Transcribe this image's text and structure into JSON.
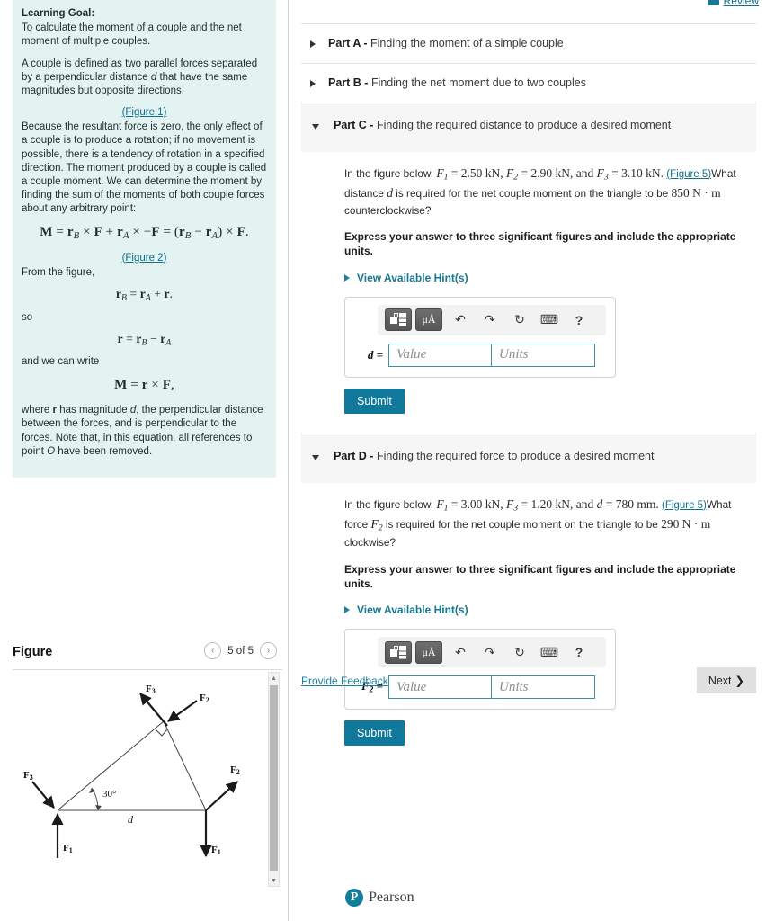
{
  "left_panel": {
    "learning_goal_title": "Learning Goal:",
    "learning_goal_text": "To calculate the moment of a couple and the net moment of multiple couples.",
    "para_couple_definition": "A couple is defined as two parallel forces separated by a perpendicular distance d that have the same magnitudes but opposite directions.",
    "figure1_link": "(Figure 1)",
    "para_resultant": "Because the resultant force is zero, the only effect of a couple is to produce a rotation; if no movement is possible, there is a tendency of rotation in a specified direction. The moment produced by a couple is called a couple moment. We can determine the moment by finding the sum of the moments of both couple forces about any arbitrary point:",
    "equation_main": "M = r_B × F + r_A × −F = (r_B − r_A) × F.",
    "figure2_link": "(Figure 2)",
    "from_the_figure": "From the figure,",
    "equation_rb": "r_B = r_A + r,",
    "so_label": "so",
    "equation_r": "r = r_B − r_A",
    "and_we_can_write": "and we can write",
    "equation_m": "M = r × F,",
    "para_where": "where r has magnitude d, the perpendicular distance between the forces, and is perpendicular to the forces. Note that, in this equation, all references to point O have been removed."
  },
  "figure_section": {
    "title": "Figure",
    "pager_prev": "‹",
    "pager_next": "›",
    "counter": "5 of 5",
    "diagram": {
      "labels": [
        "F1",
        "F2",
        "F3",
        "F1",
        "F2",
        "F3",
        "d",
        "30°"
      ],
      "angle": "30°",
      "distance_label": "d",
      "right_angle_marker": true
    }
  },
  "header": {
    "review_label": "Review",
    "review_icon": "review-icon"
  },
  "parts": [
    {
      "id": "A",
      "prefix": "Part A -",
      "title": "Finding the moment of a simple couple",
      "expanded": false
    },
    {
      "id": "B",
      "prefix": "Part B -",
      "title": "Finding the net moment due to two couples",
      "expanded": false
    },
    {
      "id": "C",
      "prefix": "Part C -",
      "title": "Finding the required distance to produce a desired moment",
      "expanded": true,
      "question_pre": "In the figure below, ",
      "question_math_1": "F₁ = 2.50 kN, F₂ = 2.90 kN, and F₃ = 3.10 kN.",
      "question_figlink": "(Figure 5)",
      "question_mid": "What distance d is required for the net couple moment on the triangle to be ",
      "question_math_2": "850 N · m",
      "question_post": " counterclockwise?",
      "instruction": "Express your answer to three significant figures and include the appropriate units.",
      "hint_label": "View Available Hint(s)",
      "var_label": "d =",
      "value_placeholder": "Value",
      "units_placeholder": "Units",
      "value_current": "",
      "units_current": "",
      "submit_label": "Submit"
    },
    {
      "id": "D",
      "prefix": "Part D -",
      "title": "Finding the required force to produce a desired moment",
      "expanded": true,
      "question_pre": "In the figure below, ",
      "question_math_1": "F₁ = 3.00 kN, F₃ = 1.20 kN, and d = 780 mm.",
      "question_figlink": "(Figure 5)",
      "question_mid": "What force F₂ is required for the net couple moment on the triangle to be ",
      "question_math_2": "290 N · m",
      "question_post": " clockwise?",
      "instruction": "Express your answer to three significant figures and include the appropriate units.",
      "hint_label": "View Available Hint(s)",
      "var_label": "F₂ =",
      "value_placeholder": "Value",
      "units_placeholder": "Units",
      "value_current": "",
      "units_current": "",
      "submit_label": "Submit"
    }
  ],
  "math_toolbar": {
    "template_button": "template-icon",
    "units_button": "μÅ",
    "undo": "↶",
    "redo": "↷",
    "reset": "↻",
    "keyboard": "⌨",
    "help": "?"
  },
  "footer": {
    "provide_feedback": "Provide Feedback",
    "next_label": "Next",
    "next_chevron": "❯",
    "brand": "Pearson",
    "brand_mark": "P"
  },
  "colors": {
    "panel_bg": "#e3f3f1",
    "link_teal": "#0f6f8c",
    "submit_bg": "#10799b",
    "part_open_bg": "#f6f6f6",
    "field_border": "#3f8ea6",
    "next_bg": "#e0e0e0"
  }
}
